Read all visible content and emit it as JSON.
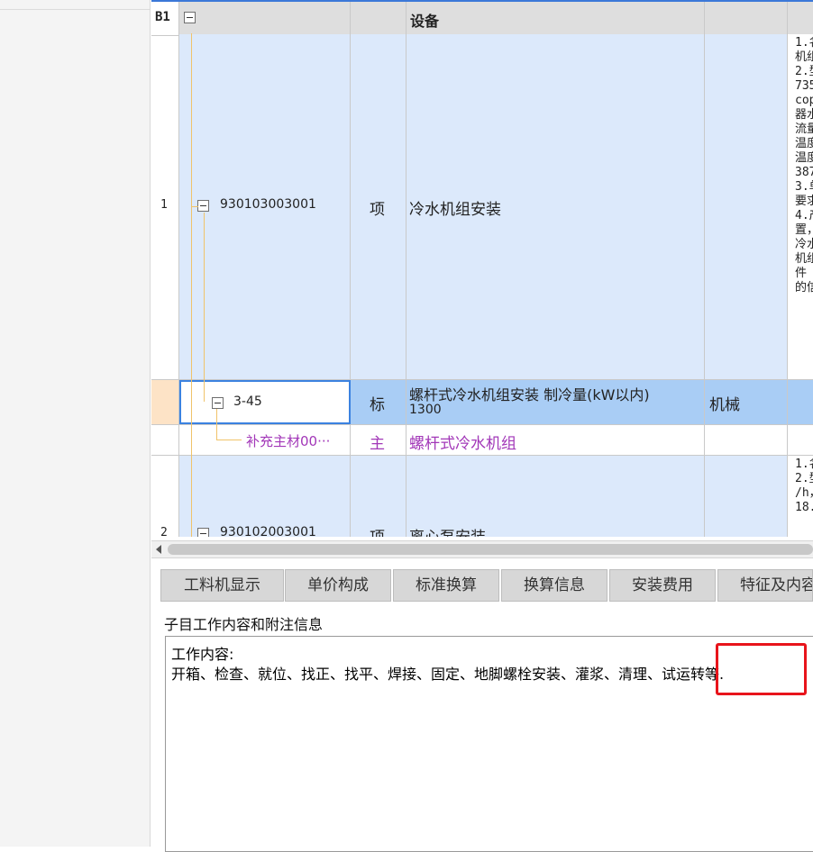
{
  "grid": {
    "header": {
      "code": "B1",
      "name": "设备"
    },
    "rows": [
      {
        "index": "1",
        "code": "930103003001",
        "type": "项",
        "name": "冷水机组安装",
        "feature": "1.名\n机组\n2.型\n735\ncop\n器水\n流量\n温度\n温度\n387\n3.单\n要求\n4.产\n置，\n冷水\n机组\n件\n的信"
      },
      {
        "code": "3-45",
        "type": "标",
        "name": "螺杆式冷水机组安装 制冷量(kW以内)",
        "name2": "1300",
        "unit": "机械"
      },
      {
        "code": "补充主材00···",
        "type": "主",
        "name": "螺杆式冷水机组"
      },
      {
        "index": "2",
        "code": "930102003001",
        "type": "项",
        "name": "离心泵安装",
        "feature": "1.名\n2.型\n/h，\n18."
      }
    ]
  },
  "tabs": [
    "工料机显示",
    "单价构成",
    "标准换算",
    "换算信息",
    "安装费用",
    "特征及内容"
  ],
  "section_label": "子目工作内容和附注信息",
  "work_content": {
    "title": "工作内容:",
    "text": "开箱、检查、就位、找正、找平、焊接、固定、地脚螺栓安装、灌浆、清理、试运转等."
  },
  "colors": {
    "header_bg": "#dedede",
    "row_blue": "#dce9fb",
    "row_selected": "#a9cdf5",
    "material_text": "#a237b8",
    "tree_line": "#f0c36a",
    "highlight_red": "#e8141b"
  }
}
